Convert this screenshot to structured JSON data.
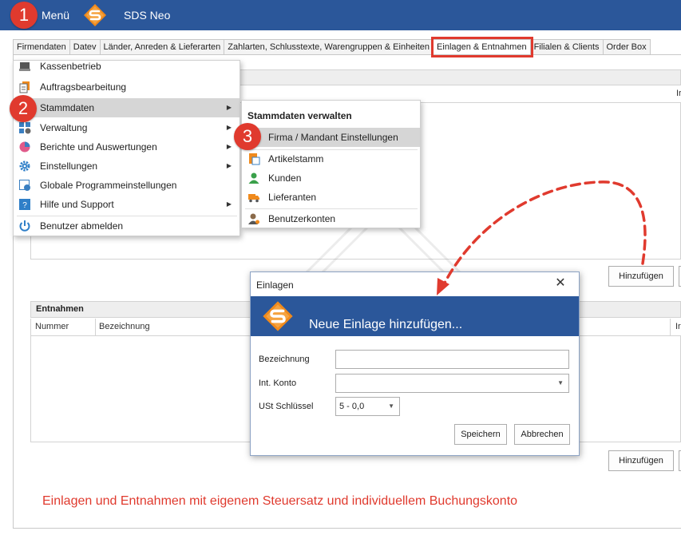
{
  "titlebar": {
    "menu_label": "Menü",
    "app_title": "SDS Neo"
  },
  "badges": {
    "one": "1",
    "two": "2",
    "three": "3"
  },
  "tabs": [
    "Firmendaten",
    "Datev",
    "Länder, Anreden & Lieferarten",
    "Zahlarten, Schlusstexte, Warengruppen & Einheiten",
    "Einlagen & Entnahmen",
    "Filialen & Clients",
    "Order Box"
  ],
  "background": {
    "col_partial_top": "Ir",
    "entnahmen_title": "Entnahmen",
    "col_nummer": "Nummer",
    "col_bezeichnung": "Bezeichnung",
    "col_partial_bottom": "Ir",
    "add_button_top": "Hinzufügen",
    "add_button_bottom": "Hinzufügen"
  },
  "main_menu": {
    "items": [
      {
        "label": "Kassenbetrieb",
        "icon": "register-icon",
        "submenu": false
      },
      {
        "label": "Auftragsbearbeitung",
        "icon": "documents-icon",
        "submenu": false
      },
      {
        "label": "Stammdaten",
        "icon": "database-icon",
        "submenu": true,
        "arrow": "▶"
      },
      {
        "label": "Verwaltung",
        "icon": "admin-icon",
        "submenu": true,
        "arrow": "▶"
      },
      {
        "label": "Berichte und Auswertungen",
        "icon": "pie-chart-icon",
        "submenu": true,
        "arrow": "▶"
      },
      {
        "label": "Einstellungen",
        "icon": "gear-icon",
        "submenu": true,
        "arrow": "▶"
      },
      {
        "label": "Globale Programmeinstellungen",
        "icon": "global-settings-icon",
        "submenu": false
      },
      {
        "label": "Hilfe und Support",
        "icon": "help-icon",
        "submenu": true,
        "arrow": "▶"
      },
      {
        "label": "Benutzer abmelden",
        "icon": "power-icon",
        "submenu": false
      }
    ]
  },
  "submenu": {
    "header": "Stammdaten verwalten",
    "items": [
      {
        "label": "Firma / Mandant Einstellungen",
        "icon": "company-icon"
      },
      {
        "label": "Artikelstamm",
        "icon": "article-icon"
      },
      {
        "label": "Kunden",
        "icon": "customer-icon"
      },
      {
        "label": "Lieferanten",
        "icon": "truck-icon"
      },
      {
        "label": "Benutzerkonten",
        "icon": "user-account-icon"
      }
    ]
  },
  "dialog": {
    "title": "Einlagen",
    "close_glyph": "✕",
    "banner_text": "Neue Einlage hinzufügen...",
    "fields": {
      "bezeichnung_label": "Bezeichnung",
      "bezeichnung_value": "",
      "konto_label": "Int. Konto",
      "konto_value": "",
      "ust_label": "USt Schlüssel",
      "ust_value": "5 - 0,0",
      "dropdown_glyph": "▼"
    },
    "save_button": "Speichern",
    "cancel_button": "Abbrechen"
  },
  "caption": "Einlagen und Entnahmen mit eigenem Steuersatz und individuellem Buchungskonto",
  "colors": {
    "accent_blue": "#2b579a",
    "highlight_red": "#e03a2e",
    "logo_orange": "#f08a1c"
  }
}
